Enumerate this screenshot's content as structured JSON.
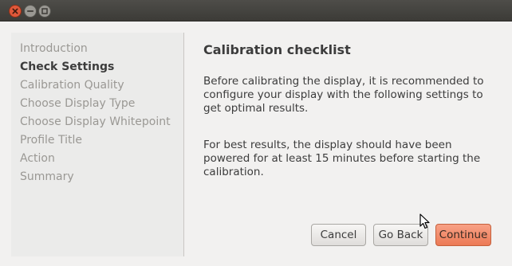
{
  "window": {
    "controls": [
      {
        "name": "close",
        "icon": "close-icon",
        "color": "#e0583a"
      },
      {
        "name": "minimize",
        "icon": "minimize-icon",
        "color": "#9a9893"
      },
      {
        "name": "maximize",
        "icon": "maximize-icon",
        "color": "#9a9893"
      }
    ]
  },
  "sidebar": {
    "steps": [
      {
        "label": "Introduction",
        "active": false
      },
      {
        "label": "Check Settings",
        "active": true
      },
      {
        "label": "Calibration Quality",
        "active": false
      },
      {
        "label": "Choose Display Type",
        "active": false
      },
      {
        "label": "Choose Display Whitepoint",
        "active": false
      },
      {
        "label": "Profile Title",
        "active": false
      },
      {
        "label": "Action",
        "active": false
      },
      {
        "label": "Summary",
        "active": false
      }
    ]
  },
  "main": {
    "heading": "Calibration checklist",
    "paragraph1": "Before calibrating the display, it is recommended to configure your display with the following settings to get optimal results.",
    "paragraph2": "For best results, the display should have been powered for at least 15 minutes before starting the calibration."
  },
  "buttons": {
    "cancel": "Cancel",
    "back": "Go Back",
    "continue": "Continue"
  },
  "colors": {
    "accent": "#ec7a55",
    "titlebar": "#3c3b37",
    "text": "#3c3c3c",
    "inactive_step": "#9a9894"
  }
}
